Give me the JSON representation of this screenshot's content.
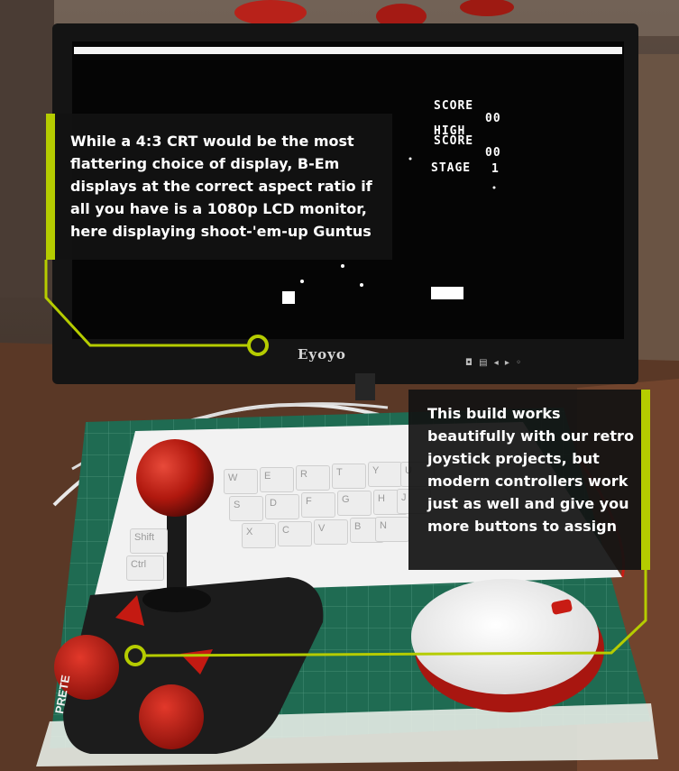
{
  "captions": {
    "monitor": "While a 4:3 CRT would be the most flattering choice of display, B-Em displays at the correct aspect ratio if all you have is a 1080p LCD monitor, here displaying shoot-'em-up Guntus",
    "controllers": "This build works beautifully with our retro joystick projects, but modern controllers work just as well and give you more buttons to assign"
  },
  "game_screen": {
    "score_label": "SCORE",
    "score_value": "00",
    "high_score_line1": "HIGH",
    "high_score_line2": "SCORE",
    "high_score_value": "00",
    "stage_label": "STAGE",
    "stage_value": "1"
  },
  "monitor": {
    "brand": "Eyoyo",
    "button_symbols": "◘ ▤ ◂ ▸ ◦"
  },
  "keyboard": {
    "keys": [
      "W",
      "E",
      "R",
      "T",
      "Y",
      "U",
      "S",
      "D",
      "F",
      "G",
      "H",
      "J",
      "X",
      "C",
      "V",
      "B",
      "N",
      "Shift",
      "Ctrl"
    ]
  },
  "cutting_mat": {
    "label": "PRETE"
  },
  "colors": {
    "callout_accent": "#b5cc00",
    "caption_background": "#121212",
    "joystick_red": "#b0180e",
    "mat_green": "#1f6b52"
  }
}
